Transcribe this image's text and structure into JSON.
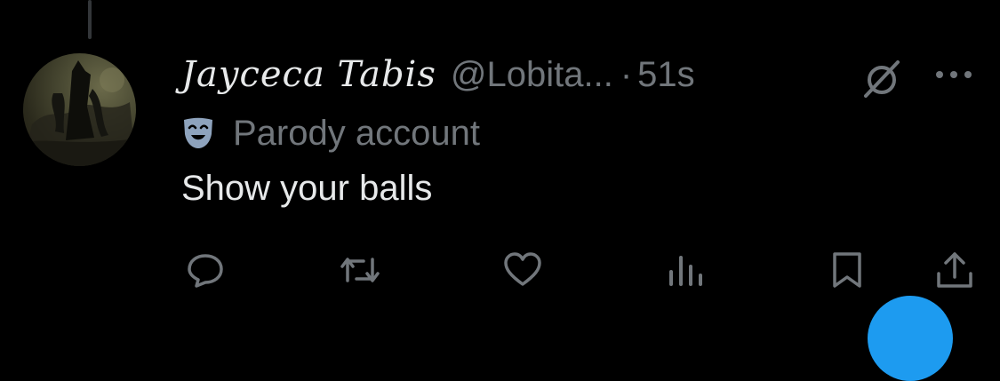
{
  "tweet": {
    "display_name": "Jayceca Tabis",
    "handle": "@Lobita...",
    "separator": "·",
    "time": "51s",
    "label": "Parody account",
    "text": "Show your balls"
  },
  "icons": {
    "grok": "grok-icon",
    "more": "more-icon",
    "mask": "theater-mask-icon",
    "reply": "reply-icon",
    "repost": "repost-icon",
    "like": "like-icon",
    "views": "views-icon",
    "bookmark": "bookmark-icon",
    "share": "share-icon"
  },
  "colors": {
    "background": "#000000",
    "primary_text": "#e7e9ea",
    "secondary_text": "#71767b",
    "accent": "#1d9bf0"
  }
}
